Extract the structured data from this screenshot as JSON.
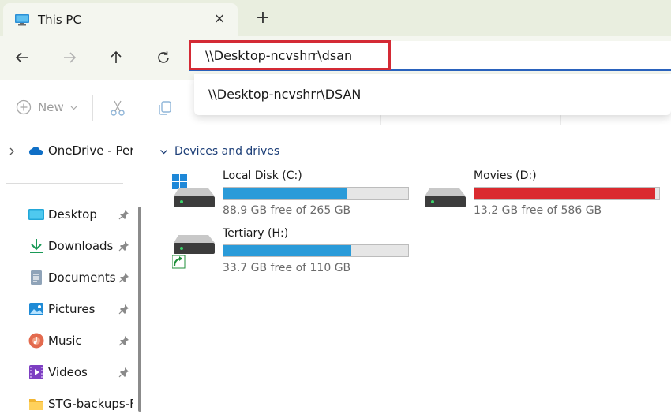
{
  "window": {
    "tab_title": "This PC",
    "close_symbol": "×",
    "new_tab_symbol": "+"
  },
  "navigation": {
    "address_value": "\\\\Desktop-ncvshrr\\dsan",
    "suggestion": "\\\\Desktop-ncvshrr\\DSAN"
  },
  "toolbar": {
    "new_label": "New"
  },
  "sidebar": {
    "onedrive": "OneDrive - Perso",
    "items": [
      {
        "label": "Desktop",
        "icon": "desktop-icon"
      },
      {
        "label": "Downloads",
        "icon": "downloads-icon"
      },
      {
        "label": "Documents",
        "icon": "documents-icon"
      },
      {
        "label": "Pictures",
        "icon": "pictures-icon"
      },
      {
        "label": "Music",
        "icon": "music-icon"
      },
      {
        "label": "Videos",
        "icon": "videos-icon"
      },
      {
        "label": "STG-backups-FF",
        "icon": "folder-icon"
      }
    ]
  },
  "content": {
    "section_title": "Devices and drives",
    "drives": [
      {
        "name": "Local Disk (C:)",
        "free_text": "88.9 GB free of 265 GB",
        "used_fraction": 0.665,
        "bar_color": "#2a9bd9"
      },
      {
        "name": "Movies (D:)",
        "free_text": "13.2 GB free of 586 GB",
        "used_fraction": 0.977,
        "bar_color": "#da2a2f"
      },
      {
        "name": "Tertiary (H:)",
        "free_text": "33.7 GB free of 110 GB",
        "used_fraction": 0.694,
        "bar_color": "#2a9bd9"
      }
    ]
  },
  "colors": {
    "accent": "#2a62bd",
    "highlight_border": "#d42a35",
    "title_bar": "#e9eedf"
  }
}
